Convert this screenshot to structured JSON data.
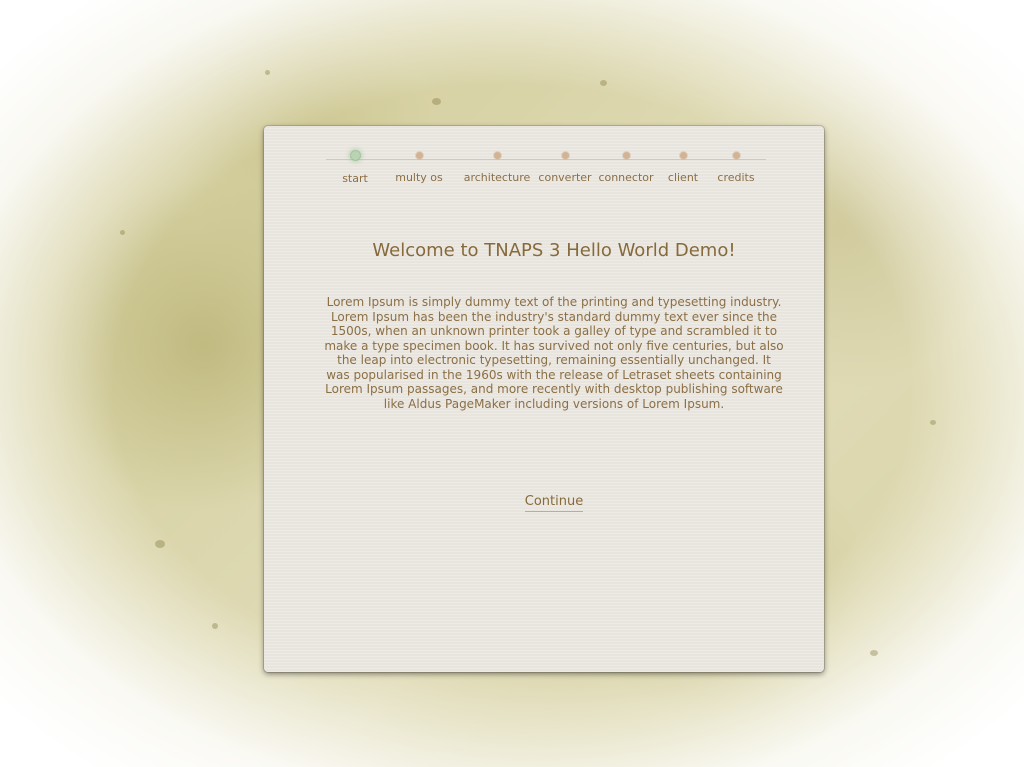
{
  "wizard": {
    "steps": [
      {
        "label": "start",
        "active": true
      },
      {
        "label": "multy os",
        "active": false
      },
      {
        "label": "architecture",
        "active": false
      },
      {
        "label": "converter",
        "active": false
      },
      {
        "label": "connector",
        "active": false
      },
      {
        "label": "client",
        "active": false
      },
      {
        "label": "credits",
        "active": false
      }
    ]
  },
  "main": {
    "title": "Welcome to TNAPS 3 Hello World Demo!",
    "body": "Lorem Ipsum is simply dummy text of the printing and typesetting industry. Lorem Ipsum has been the industry's standard dummy text ever since the 1500s, when an unknown printer took a galley of type and scrambled it to make a type specimen book. It has survived not only five centuries, but also the leap into electronic typesetting, remaining essentially unchanged. It was popularised in the 1960s with the release of Letraset sheets containing Lorem Ipsum passages, and more recently with desktop publishing software like Aldus PageMaker including versions of Lorem Ipsum.",
    "continue_label": "Continue"
  },
  "colors": {
    "text": "#8b6f45",
    "active_dot": "#b9d3b3",
    "inactive_dot": "#d2b394",
    "panel": "#ece8e2"
  }
}
